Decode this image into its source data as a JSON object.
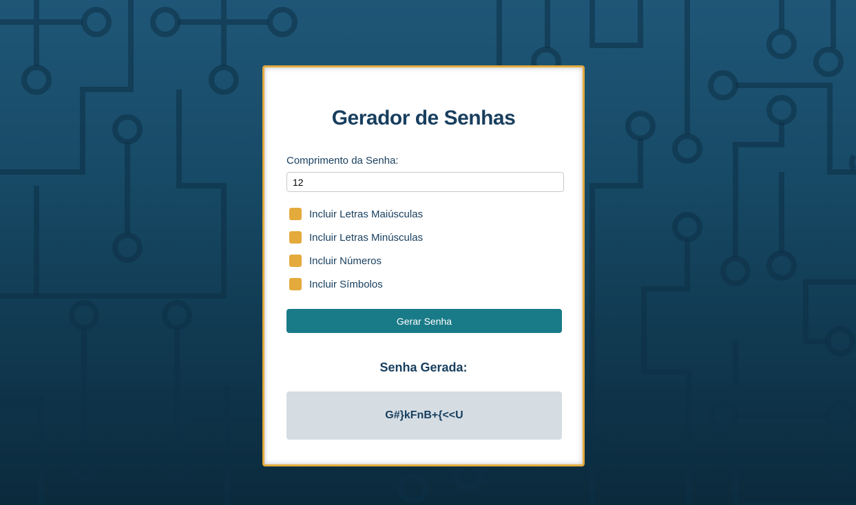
{
  "app": {
    "title": "Gerador de Senhas"
  },
  "form": {
    "length_label": "Comprimento da Senha:",
    "length_value": "12",
    "options": [
      {
        "label": "Incluir Letras Maiúsculas",
        "checked": true
      },
      {
        "label": "Incluir Letras Minúsculas",
        "checked": true
      },
      {
        "label": "Incluir Números",
        "checked": true
      },
      {
        "label": "Incluir Símbolos",
        "checked": true
      }
    ],
    "generate_label": "Gerar Senha"
  },
  "result": {
    "heading": "Senha Gerada:",
    "password": "G#}kFnB+{<<U"
  },
  "colors": {
    "accent": "#e4aa3c",
    "button": "#1a7b88",
    "text": "#173e5e",
    "result_bg": "#d5dde3"
  }
}
